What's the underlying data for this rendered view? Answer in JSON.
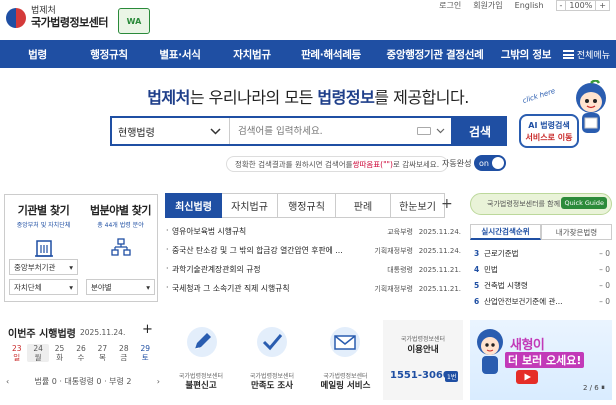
{
  "header": {
    "org_small": "법제처",
    "org_main": "국가법령정보센터",
    "cert_badge": "WA",
    "top_links": [
      "로그인",
      "회원가입",
      "English"
    ],
    "font_size": {
      "minus": "-",
      "value": "100%",
      "plus": "+"
    }
  },
  "nav": {
    "items": [
      "법령",
      "행정규칙",
      "별표·서식",
      "자치법규",
      "판례·해석례등",
      "중앙행정기관 결정선례",
      "그밖의 정보"
    ],
    "all_menu": "전체메뉴"
  },
  "hero": {
    "title_pre": "법제처",
    "title_mid": "는 우리나라의 모든 ",
    "title_bold": "법령정보",
    "title_post": "를 제공합니다."
  },
  "search": {
    "scope": "현행법령",
    "placeholder": "검색어를 입력하세요.",
    "button": "검색",
    "hint_pre": "정확한 검색결과를 원하시면 검색어를 ",
    "hint_em": "쌍따옴표(\"\")",
    "hint_post": "로 감싸보세요.",
    "auto_label": "자동완성",
    "auto_value": "on"
  },
  "ai": {
    "click": "click here",
    "line1": "AI 법령검색",
    "line2": "서비스로 이동"
  },
  "left_panel": {
    "col1": {
      "title": "기관별 찾기",
      "sub": "중앙부처 및 자치단체",
      "select1": "중앙부처기관",
      "select2": "자치단체"
    },
    "col2": {
      "title": "법분야별 찾기",
      "sub": "총 44개 법령 분야",
      "select1": "분야별"
    }
  },
  "tabs": [
    "최신법령",
    "자치법규",
    "행정규칙",
    "판례",
    "한눈보기"
  ],
  "law_list": [
    {
      "title": "영유아보육법 시행규칙",
      "dept": "교육부령",
      "date": "2025.11.24."
    },
    {
      "title": "중국산 탄소강 및 그 밖의 합금강 열간압연 후판에 ...",
      "dept": "기획재정부령",
      "date": "2025.11.24."
    },
    {
      "title": "과학기술관계장관회의 규정",
      "dept": "대통령령",
      "date": "2025.11.21."
    },
    {
      "title": "국세청과 그 소속기관 직제 시행규칙",
      "dept": "기획재정부령",
      "date": "2025.11.21."
    }
  ],
  "right_panel": {
    "banner": "국가법령정보센터를 함께 활용하는 방법",
    "banner_badge": "Quick Guide",
    "tabs": [
      "실시간검색순위",
      "내가찾은법령"
    ],
    "ranks": [
      {
        "n": "3",
        "title": "근로기준법",
        "change": "0"
      },
      {
        "n": "4",
        "title": "민법",
        "change": "0"
      },
      {
        "n": "5",
        "title": "건축법 시행령",
        "change": "0"
      },
      {
        "n": "6",
        "title": "산업안전보건기준에 관...",
        "change": "0"
      }
    ]
  },
  "weekly": {
    "title": "이번주 시행법령",
    "date": "2025.11.24.",
    "days": [
      {
        "num": "23",
        "dow": "일"
      },
      {
        "num": "24",
        "dow": "월"
      },
      {
        "num": "25",
        "dow": "화"
      },
      {
        "num": "26",
        "dow": "수"
      },
      {
        "num": "27",
        "dow": "목"
      },
      {
        "num": "28",
        "dow": "금"
      },
      {
        "num": "29",
        "dow": "토"
      }
    ],
    "counts": "법률 0 · 대통령령 0 · 부령 2"
  },
  "cards": [
    {
      "small": "국가법령정보센터",
      "main": "불편신고"
    },
    {
      "small": "국가법령정보센터",
      "main": "만족도 조사"
    },
    {
      "small": "국가법령정보센터",
      "main": "메일링 서비스"
    }
  ],
  "phone_card": {
    "small": "국가법령정보센터",
    "main": "이용안내",
    "number": "1551-3060",
    "badge": "1번"
  },
  "promo": {
    "line1": "새형이",
    "line2": "더 보러 오세요!",
    "page": "2 / 6"
  },
  "colors": {
    "primary": "#1f4fa3",
    "accent_red": "#c82828",
    "promo_pink": "#c23ab8"
  }
}
